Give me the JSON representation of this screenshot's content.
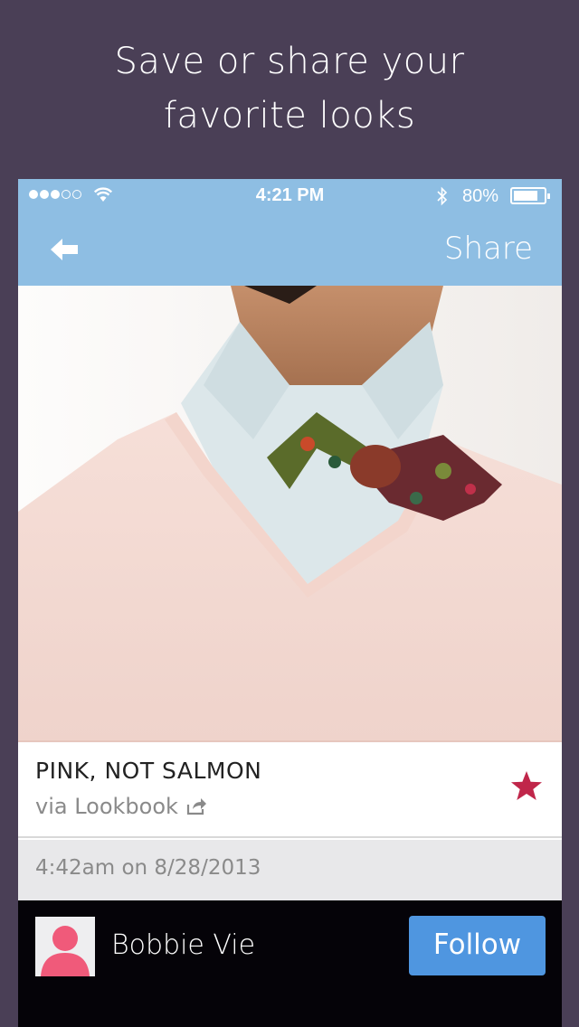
{
  "promo": {
    "line1": "Save or share your",
    "line2": "favorite looks"
  },
  "status_bar": {
    "time": "4:21 PM",
    "battery_percent": "80%",
    "battery_level": 0.8,
    "signal_bars_filled": 3,
    "signal_bars_total": 5
  },
  "navbar": {
    "back_icon": "back-arrow-icon",
    "share_label": "Share"
  },
  "post": {
    "image_description_icon": "photo-pink-sweater-bowtie",
    "title": "PINK, NOT SALMON",
    "source": "via Lookbook",
    "source_icon": "external-share-icon",
    "starred": true,
    "timestamp": "4:42am on 8/28/2013"
  },
  "user": {
    "name": "Bobbie Vie",
    "avatar_icon": "default-avatar-icon",
    "follow_label": "Follow"
  },
  "colors": {
    "background": "#4a3f56",
    "bar_blue": "#8ebee3",
    "follow_blue": "#4f96e0",
    "star_red": "#c0264a",
    "avatar_pink": "#f05a7a"
  }
}
